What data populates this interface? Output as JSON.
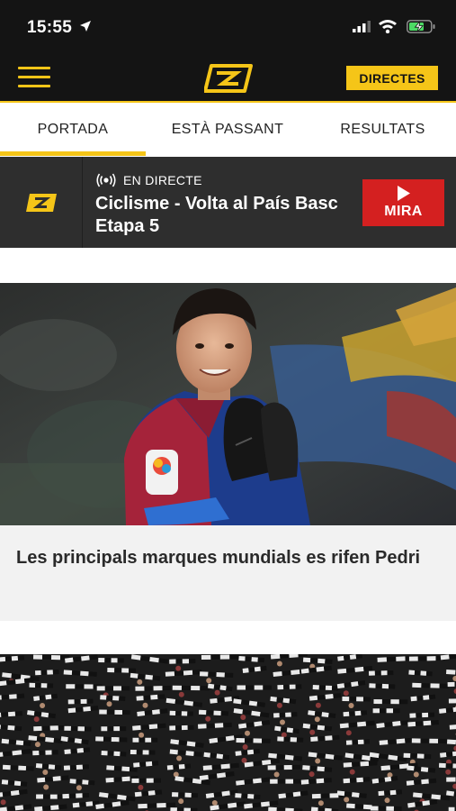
{
  "status_bar": {
    "time": "15:55",
    "icons": [
      "location-arrow-icon",
      "cellular-signal-icon",
      "wifi-icon",
      "battery-charging-icon"
    ]
  },
  "header": {
    "menu_icon": "hamburger-menu-icon",
    "logo_icon": "esport3-logo-icon",
    "directes_label": "DIRECTES"
  },
  "tabs": [
    {
      "label": "PORTADA",
      "active": true
    },
    {
      "label": "ESTÀ PASSANT",
      "active": false
    },
    {
      "label": "RESULTATS",
      "active": false
    }
  ],
  "live": {
    "tag": "EN DIRECTE",
    "title": "Ciclisme - Volta al País Basc Etapa 5",
    "watch_label": "MIRA",
    "tag_icon": "broadcast-icon",
    "channel_icon": "esport3-logo-icon",
    "watch_icon": "play-icon"
  },
  "articles": [
    {
      "headline": "Les principals marques mundials es rifen Pedri",
      "image": "footballer-applauding-photo"
    },
    {
      "headline": "",
      "image": "stadium-crowd-scarves-photo"
    }
  ],
  "colors": {
    "brand_yellow": "#f5c518",
    "header_bg": "#141414",
    "live_bg": "#2e2e2e",
    "mira_red": "#d42020"
  }
}
